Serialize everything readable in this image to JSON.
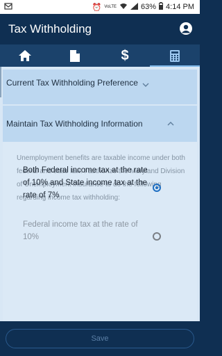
{
  "status_bar": {
    "volte_label": "VoLTE",
    "battery": "63%",
    "time": "4:14 PM"
  },
  "app_bar": {
    "title": "Tax Withholding"
  },
  "tabs": [
    {
      "icon": "home-icon",
      "active": false
    },
    {
      "icon": "document-icon",
      "active": false
    },
    {
      "icon": "dollar-icon",
      "active": false
    },
    {
      "icon": "calculator-icon",
      "active": true
    }
  ],
  "panels": {
    "current_preference": {
      "label": "Current Tax Withholding Preference"
    },
    "maintain_info": {
      "label": "Maintain Tax Withholding Information"
    }
  },
  "info_text": "Unemployment benefits are taxable income under both federal and state law. I authorize the Maryland Division of Unemployment Insurance to do the following regarding income tax withholding:",
  "options": [
    {
      "label": "Both Federal income tax at the rate of 10% and State income tax at the rate of 7%",
      "selected": true
    },
    {
      "label": "Federal income tax at the rate of 10%",
      "selected": false
    }
  ],
  "footer": {
    "save_label": "Save"
  },
  "colors": {
    "primary": "#0f2f52",
    "accent": "#1f6fc2",
    "panel": "#bcd7f0"
  }
}
